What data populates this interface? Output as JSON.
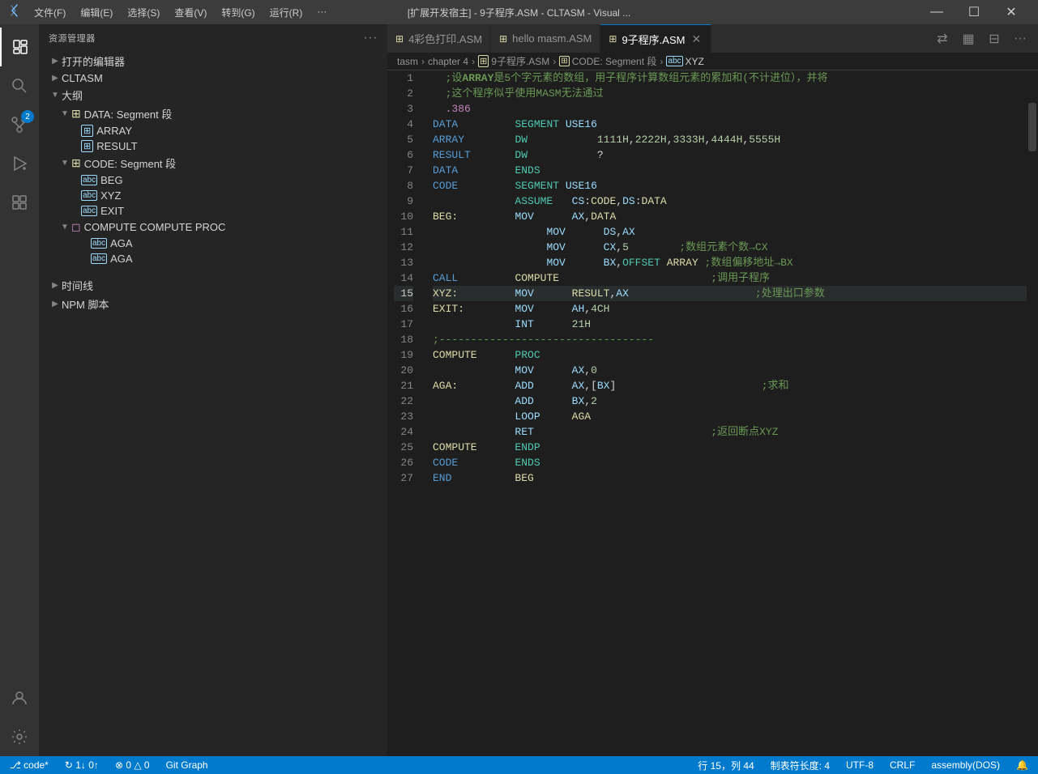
{
  "titlebar": {
    "icon": "⬡",
    "menu_items": [
      "文件(F)",
      "编辑(E)",
      "选择(S)",
      "查看(V)",
      "转到(G)",
      "运行(R)",
      "···"
    ],
    "title": "[扩展开发宿主] - 9子程序.ASM - CLTASM - Visual ...",
    "controls": [
      "—",
      "☐",
      "✕"
    ]
  },
  "activity_bar": {
    "items": [
      {
        "icon": "⊞",
        "name": "explorer",
        "active": true
      },
      {
        "icon": "🔍",
        "name": "search"
      },
      {
        "icon": "⑂",
        "name": "source-control",
        "badge": "2"
      },
      {
        "icon": "▷",
        "name": "run"
      },
      {
        "icon": "⊡",
        "name": "extensions"
      },
      {
        "icon": "👤",
        "name": "account"
      },
      {
        "icon": "⚙",
        "name": "settings"
      }
    ]
  },
  "sidebar": {
    "title": "资源管理器",
    "sections": [
      {
        "label": "打开的编辑器",
        "collapsed": true,
        "indent": 1
      },
      {
        "label": "CLTASM",
        "collapsed": false,
        "indent": 1
      },
      {
        "label": "大纲",
        "collapsed": false,
        "indent": 1
      }
    ],
    "tree": [
      {
        "label": "DATA: Segment 段",
        "indent": 2,
        "type": "segment",
        "collapsed": false
      },
      {
        "label": "ARRAY",
        "indent": 3,
        "type": "var"
      },
      {
        "label": "RESULT",
        "indent": 3,
        "type": "var"
      },
      {
        "label": "CODE: Segment 段",
        "indent": 2,
        "type": "segment",
        "collapsed": false
      },
      {
        "label": "BEG",
        "indent": 3,
        "type": "label"
      },
      {
        "label": "XYZ",
        "indent": 3,
        "type": "label"
      },
      {
        "label": "EXIT",
        "indent": 3,
        "type": "label"
      },
      {
        "label": "COMPUTE  COMPUTE   PROC",
        "indent": 2,
        "type": "proc",
        "collapsed": false
      },
      {
        "label": "AGA",
        "indent": 4,
        "type": "label"
      },
      {
        "label": "AGA",
        "indent": 4,
        "type": "label"
      }
    ],
    "bottom": [
      {
        "label": "时间线",
        "collapsed": true
      },
      {
        "label": "NPM 脚本",
        "collapsed": true
      }
    ]
  },
  "tabs": [
    {
      "label": "4彩色打印.ASM",
      "icon": "📄",
      "active": false
    },
    {
      "label": "hello masm.ASM",
      "icon": "📄",
      "active": false
    },
    {
      "label": "9子程序.ASM",
      "icon": "📄",
      "active": true
    }
  ],
  "breadcrumb": [
    {
      "label": "tasm"
    },
    {
      "label": "chapter 4"
    },
    {
      "label": "9子程序.ASM",
      "icon": true
    },
    {
      "label": "CODE: Segment 段",
      "icon": true
    },
    {
      "label": "XYZ",
      "type": "abc"
    }
  ],
  "code": {
    "lines": [
      {
        "num": 1,
        "content": "comment1"
      },
      {
        "num": 2,
        "content": "comment2"
      },
      {
        "num": 3,
        "content": "directive386"
      },
      {
        "num": 4,
        "content": "data_segment"
      },
      {
        "num": 5,
        "content": "array_dw"
      },
      {
        "num": 6,
        "content": "result_dw"
      },
      {
        "num": 7,
        "content": "data_ends"
      },
      {
        "num": 8,
        "content": "code_segment"
      },
      {
        "num": 9,
        "content": "assume"
      },
      {
        "num": 10,
        "content": "beg_mov"
      },
      {
        "num": 11,
        "content": "mov_ds"
      },
      {
        "num": 12,
        "content": "mov_cx"
      },
      {
        "num": 13,
        "content": "mov_bx"
      },
      {
        "num": 14,
        "content": "call_compute"
      },
      {
        "num": 15,
        "content": "xyz_mov"
      },
      {
        "num": 16,
        "content": "exit_mov"
      },
      {
        "num": 17,
        "content": "int_21"
      },
      {
        "num": 18,
        "content": "dashes"
      },
      {
        "num": 19,
        "content": "compute_proc"
      },
      {
        "num": 20,
        "content": "mov_ax0"
      },
      {
        "num": 21,
        "content": "aga_add"
      },
      {
        "num": 22,
        "content": "add_bx2"
      },
      {
        "num": 23,
        "content": "loop_aga"
      },
      {
        "num": 24,
        "content": "ret"
      },
      {
        "num": 25,
        "content": "compute_endp"
      },
      {
        "num": 26,
        "content": "code_ends"
      },
      {
        "num": 27,
        "content": "end_beg"
      }
    ]
  },
  "status": {
    "left": [
      {
        "text": "⎇ code*"
      },
      {
        "text": "↻ 1↓ 0↑"
      },
      {
        "text": "⊗ 0  △ 0"
      },
      {
        "text": "Git Graph"
      }
    ],
    "right": [
      {
        "text": "行 15，列 44"
      },
      {
        "text": "制表符长度: 4"
      },
      {
        "text": "UTF-8"
      },
      {
        "text": "CRLF"
      },
      {
        "text": "assembly(DOS)"
      },
      {
        "text": "🔔"
      }
    ]
  }
}
